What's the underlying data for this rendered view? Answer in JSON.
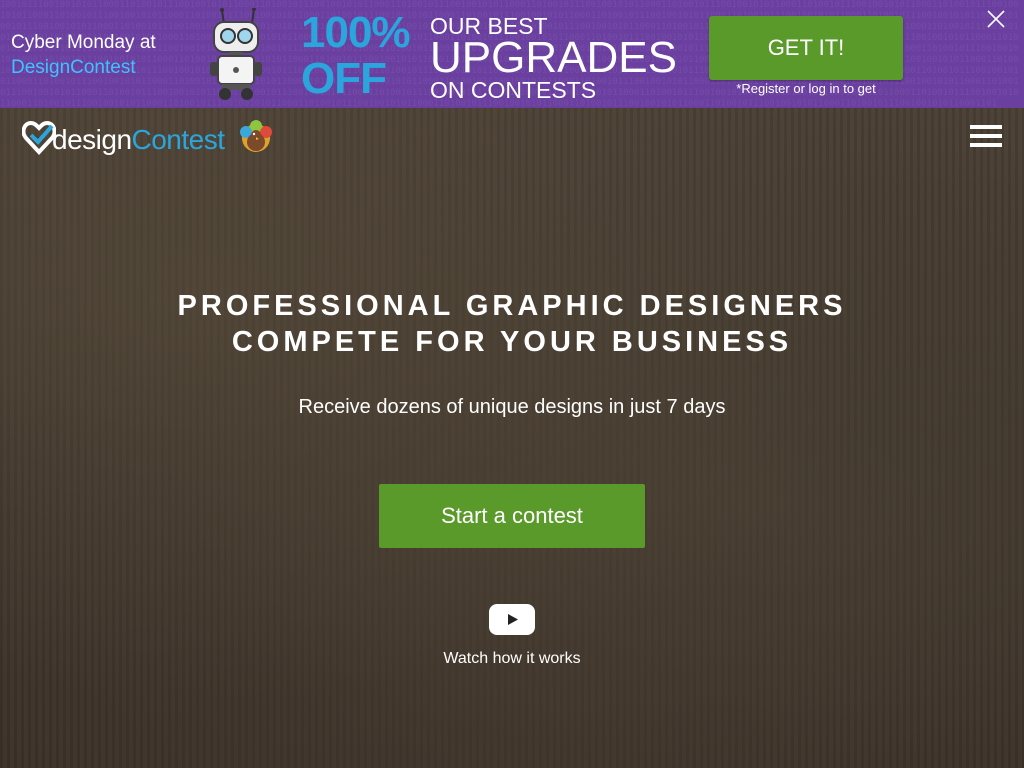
{
  "banner": {
    "intro_line1": "Cyber Monday at",
    "intro_brand": "DesignContest",
    "discount_value": "100%",
    "discount_word": "OFF",
    "headline_top": "OUR BEST",
    "headline_main": "UPGRADES",
    "headline_bottom": "ON CONTESTS",
    "cta_label": "GET IT!",
    "cta_note": "*Register or log in to get",
    "background_color": "#6a3fa0",
    "accent_color": "#2aa6dc",
    "cta_color": "#5a9a2a",
    "close_icon": "close-icon",
    "mascot_icon": "robot-mascot"
  },
  "header": {
    "logo_part1": "design",
    "logo_part2": "Contest",
    "logo_icon": "heart-check-logo",
    "menu_icon": "hamburger-menu-icon"
  },
  "hero": {
    "headline_line1": "PROFESSIONAL GRAPHIC DESIGNERS",
    "headline_line2": "COMPETE FOR YOUR BUSINESS",
    "subheadline": "Receive dozens of unique designs in just 7 days",
    "cta_label": "Start a contest",
    "video_icon": "youtube-play-icon",
    "video_link": "Watch how it works"
  }
}
